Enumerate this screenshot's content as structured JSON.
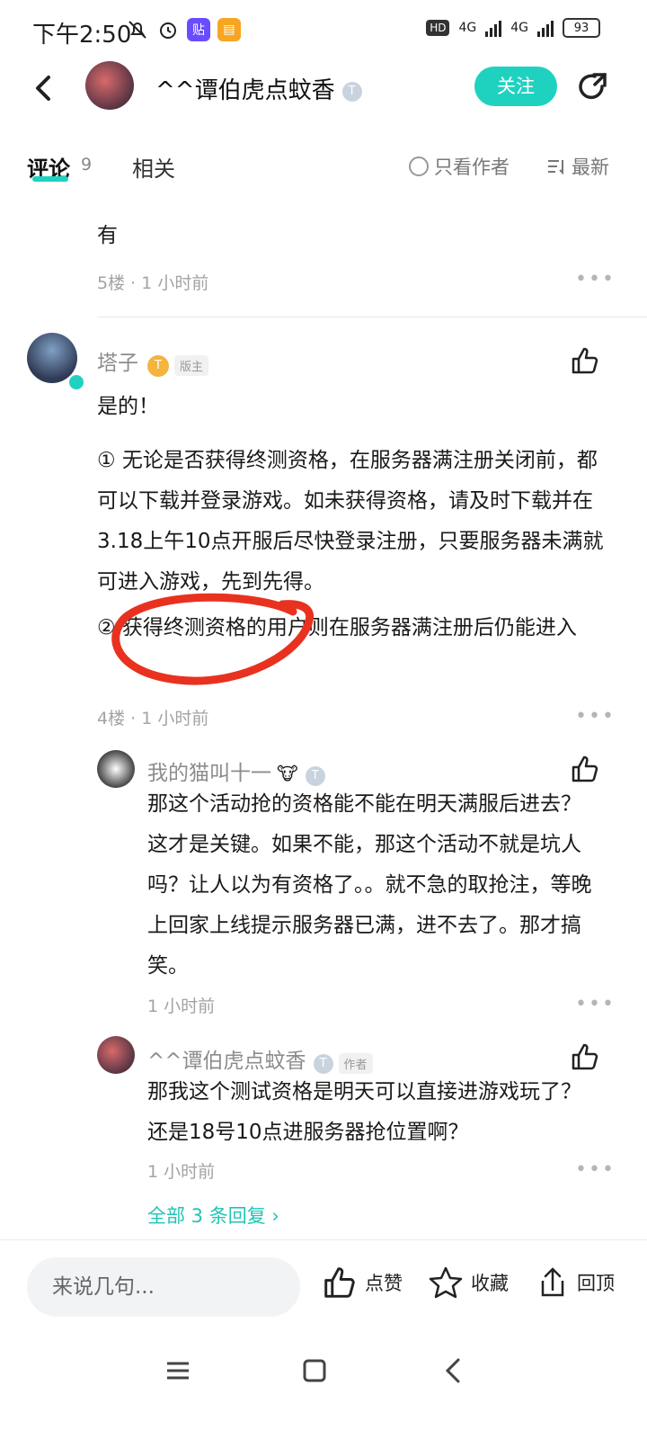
{
  "status": {
    "time": "下午2:50",
    "battery": "93",
    "hd": "HD",
    "net1": "4G",
    "net2": "4G"
  },
  "header": {
    "username": "^^谭伯虎点蚊香",
    "level": "T",
    "follow_label": "关注"
  },
  "tabs": {
    "comment": "评论",
    "comment_count": "9",
    "related": "相关",
    "only_author": "只看作者",
    "sort": "最新"
  },
  "partial": {
    "last_line": "有",
    "meta": "5楼 · 1 小时前"
  },
  "main_comment": {
    "user": "塔子",
    "level": "T",
    "role": "版主",
    "p1": "是的！",
    "p2": "① 无论是否获得终测资格，在服务器满注册关闭前，都可以下载并登录游戏。如未获得资格，请及时下载并在3.18上午10点开服后尽快登录注册，只要服务器未满就可进入游戏，先到先得。",
    "p3": "② 获得终测资格的用户则在服务器满注册后仍能进入",
    "meta": "4楼 · 1 小时前"
  },
  "replies": [
    {
      "user": "我的猫叫十一",
      "level": "T",
      "text": "那这个活动抢的资格能不能在明天满服后进去？这才是关键。如果不能，那这个活动不就是坑人吗？让人以为有资格了。。就不急的取抢注，等晚上回家上线提示服务器已满，进不去了。那才搞笑。",
      "meta": "1 小时前"
    },
    {
      "user": "^^谭伯虎点蚊香",
      "level": "T",
      "role": "作者",
      "text": "那我这个测试资格是明天可以直接进游戏玩了？还是18号10点进服务器抢位置啊？",
      "meta": "1 小时前"
    }
  ],
  "all_replies": "全部 3 条回复 ›",
  "bottom": {
    "input_placeholder": "来说几句...",
    "like": "点赞",
    "favorite": "收藏",
    "top": "回顶"
  },
  "colors": {
    "accent": "#1fd2c0",
    "annotation": "#e8321f"
  }
}
